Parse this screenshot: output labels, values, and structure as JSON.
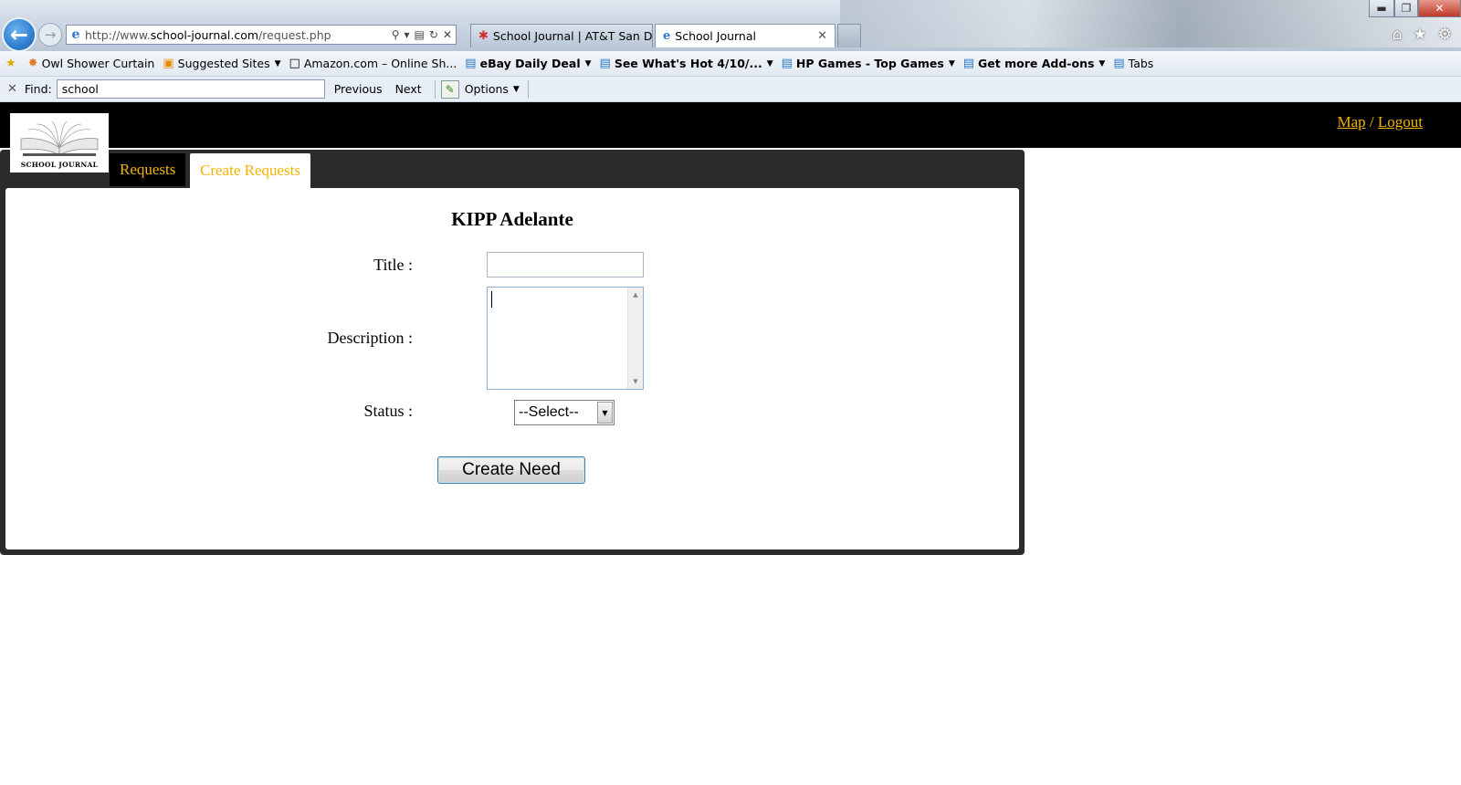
{
  "browser": {
    "address": {
      "prefix": "http://www.",
      "domain": "school-journal.com",
      "path": "/request.php"
    },
    "tabs": [
      {
        "label": "School Journal | AT&T San Die..."
      },
      {
        "label": "School Journal"
      }
    ],
    "favorites": [
      {
        "label": "Owl Shower Curtain"
      },
      {
        "label": "Suggested Sites"
      },
      {
        "label": "Amazon.com – Online Sh..."
      },
      {
        "label": "eBay Daily Deal"
      },
      {
        "label": "See What's Hot 4/10/..."
      },
      {
        "label": "HP Games - Top Games"
      },
      {
        "label": "Get more Add-ons"
      },
      {
        "label": "Tabs"
      }
    ],
    "find": {
      "label": "Find:",
      "value": "school",
      "previous": "Previous",
      "next": "Next",
      "options": "Options"
    }
  },
  "site": {
    "logo_text": "SCHOOL JOURNAL",
    "header_links": {
      "map": "Map",
      "separator": " / ",
      "logout": "Logout"
    },
    "tabs": {
      "requests": "Requests",
      "create_requests": "Create Requests"
    }
  },
  "form": {
    "school_name": "KIPP Adelante",
    "title_label": "Title :",
    "description_label": "Description :",
    "status_label": "Status :",
    "status_selected": "--Select--",
    "submit_label": "Create Need"
  },
  "colors": {
    "accent_gold": "#f0b400",
    "header_black": "#000000",
    "panel_dark": "#2b2b2b"
  }
}
